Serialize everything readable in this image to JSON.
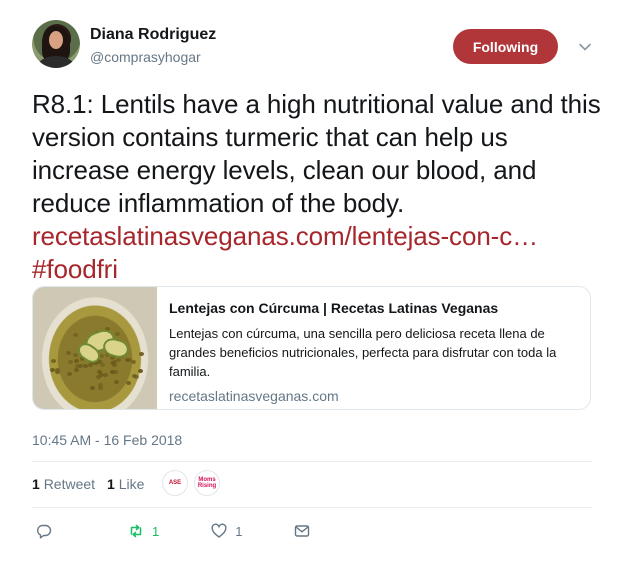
{
  "user": {
    "display_name": "Diana Rodriguez",
    "handle": "@comprasyhogar",
    "follow_label": "Following"
  },
  "tweet": {
    "text": "R8.1: Lentils have a high nutritional value and this version contains turmeric that can help us increase energy levels, clean our blood, and reduce inflammation of the body. ",
    "link_text": "recetaslatinasveganas.com/lentejas-con-c…",
    "hashtag": "#foodfri"
  },
  "card": {
    "title": "Lentejas con Cúrcuma | Recetas Latinas Veganas",
    "description": "Lentejas con cúrcuma, una sencilla pero deliciosa receta llena de grandes beneficios nutricionales, perfecta para disfrutar con toda la familia.",
    "domain": "recetaslatinasveganas.com"
  },
  "timestamp": "10:45 AM - 16 Feb 2018",
  "stats": {
    "retweet_count": "1",
    "retweet_label": "Retweet",
    "like_count": "1",
    "like_label": "Like"
  },
  "likers": [
    {
      "name": "liker-avatar-1",
      "text": "ASE"
    },
    {
      "name": "liker-avatar-2",
      "text": "Moms Rising"
    }
  ],
  "actions": {
    "reply_count": "",
    "retweet_count": "1",
    "like_count": "1"
  },
  "colors": {
    "accent": "#b0363a",
    "link": "#a6262b",
    "retweet_green": "#17bf63",
    "muted": "#657786"
  },
  "icons": {
    "reply": "reply-icon",
    "retweet": "retweet-icon",
    "like": "heart-icon",
    "dm": "envelope-icon",
    "caret": "chevron-down-icon"
  }
}
